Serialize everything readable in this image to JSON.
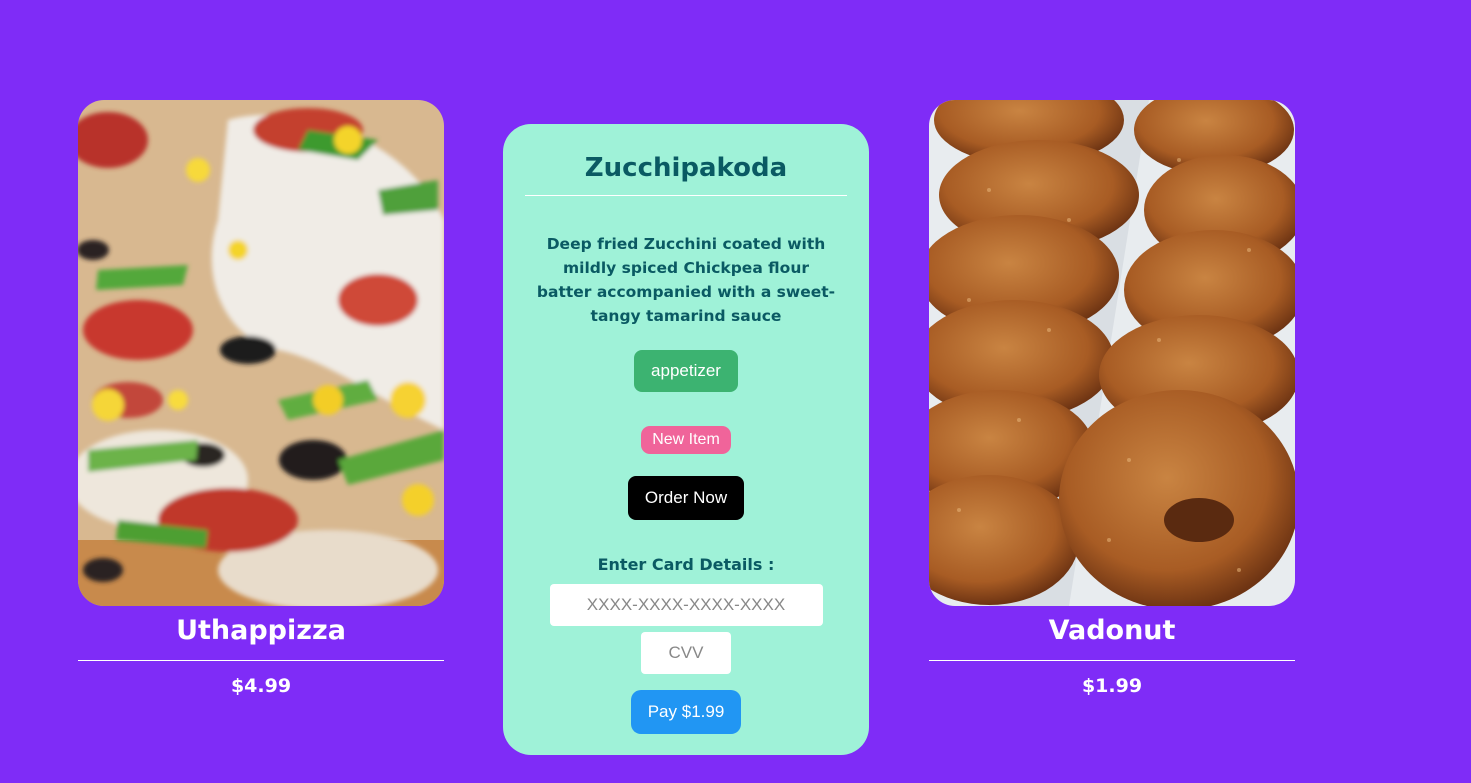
{
  "background_color": "#7f2cf7",
  "products": {
    "left": {
      "name": "Uthappizza",
      "price": "$4.99",
      "image_icon": "pizza-photo"
    },
    "right": {
      "name": "Vadonut",
      "price": "$1.99",
      "image_icon": "donut-photo"
    }
  },
  "detail": {
    "card_color": "#9ff2d8",
    "title": "Zucchipakoda",
    "description": "Deep fried Zucchini coated with mildly spiced Chickpea flour batter accompanied with a sweet-tangy tamarind sauce",
    "category_label": "appetizer",
    "badge_label": "New Item",
    "order_label": "Order Now",
    "payment": {
      "label": "Enter Card Details :",
      "card_number_placeholder": "XXXX-XXXX-XXXX-XXXX",
      "cvv_placeholder": "CVV",
      "pay_label": "Pay $1.99"
    }
  }
}
